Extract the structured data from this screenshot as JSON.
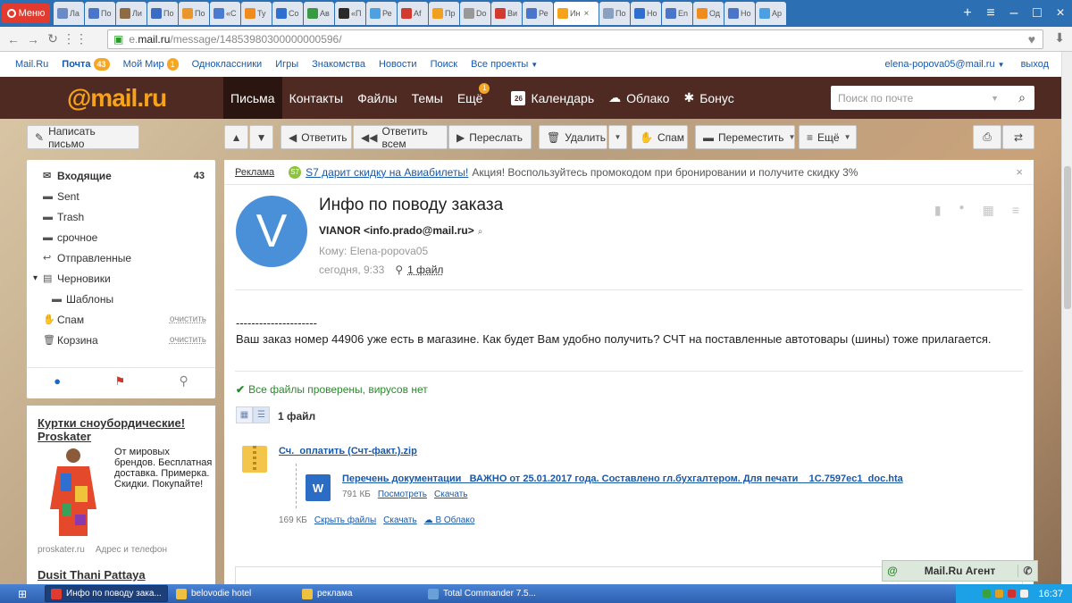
{
  "browser": {
    "menu_label": "Меню",
    "tabs": [
      {
        "title": "Ла",
        "color": "#6b8bc7"
      },
      {
        "title": "По",
        "color": "#4a75c9"
      },
      {
        "title": "Ли",
        "color": "#8c6b45"
      },
      {
        "title": "По",
        "color": "#3b6cc4"
      },
      {
        "title": "По",
        "color": "#e9962c"
      },
      {
        "title": "«С",
        "color": "#4a7bd0"
      },
      {
        "title": "Ту",
        "color": "#f08c1e"
      },
      {
        "title": "Co",
        "color": "#2f6fd0"
      },
      {
        "title": "Ав",
        "color": "#3a9a44"
      },
      {
        "title": "«П",
        "color": "#2a2a2a"
      },
      {
        "title": "Ре",
        "color": "#4fa0e0"
      },
      {
        "title": "Af",
        "color": "#d23a2f"
      },
      {
        "title": "Пр",
        "color": "#f0a020"
      },
      {
        "title": "Do",
        "color": "#999999"
      },
      {
        "title": "Ви",
        "color": "#d23a2f"
      },
      {
        "title": "Ре",
        "color": "#4a75c9"
      },
      {
        "title": "Ин",
        "color": "#f7a21b",
        "active": true
      },
      {
        "title": "По",
        "color": "#8aa0c0"
      },
      {
        "title": "Но",
        "color": "#2f6fd0"
      },
      {
        "title": "En",
        "color": "#4a75c9"
      },
      {
        "title": "Од",
        "color": "#f08c1e"
      },
      {
        "title": "Но",
        "color": "#4a75c9"
      },
      {
        "title": "Ар",
        "color": "#4aa0e0"
      }
    ],
    "url_prefix": "e.",
    "url_domain": "mail.ru",
    "url_path": "/message/14853980300000000596/"
  },
  "portal": {
    "links": [
      "Mail.Ru",
      "Почта",
      "Мой Мир",
      "Одноклассники",
      "Игры",
      "Знакомства",
      "Новости",
      "Поиск",
      "Все проекты"
    ],
    "mail_badge": "43",
    "world_badge": "1",
    "user": "elena-popova05@mail.ru",
    "logout": "выход"
  },
  "header": {
    "logo": "@mail.ru",
    "nav": [
      "Письма",
      "Контакты",
      "Файлы",
      "Темы",
      "Ещё"
    ],
    "more_badge": "1",
    "calendar": "Календарь",
    "calendar_day": "26",
    "cloud": "Облако",
    "bonus": "Бонус",
    "search_placeholder": "Поиск по почте"
  },
  "toolbar": {
    "compose": "Написать письмо",
    "reply": "Ответить",
    "reply_all": "Ответить всем",
    "forward": "Переслать",
    "delete": "Удалить",
    "spam": "Спам",
    "move": "Переместить",
    "more": "Ещё"
  },
  "folders": [
    {
      "name": "Входящие",
      "count": "43",
      "icon": "envelope-icon",
      "selected": true
    },
    {
      "name": "Sent",
      "icon": "folder-icon"
    },
    {
      "name": "Trash",
      "icon": "folder-icon"
    },
    {
      "name": "срочное",
      "icon": "folder-icon"
    },
    {
      "name": "Отправленные",
      "icon": "reply-icon"
    },
    {
      "name": "Черновики",
      "icon": "draft-icon"
    },
    {
      "name": "Шаблоны",
      "icon": "folder-icon",
      "indent": true
    },
    {
      "name": "Спам",
      "icon": "thumbs-down-icon",
      "clear": "очистить"
    },
    {
      "name": "Корзина",
      "icon": "trash-icon",
      "clear": "очистить"
    }
  ],
  "promo": {
    "title": "Куртки сноубордические! Proskater",
    "text": "От мировых брендов. Бесплатная доставка. Примерка. Скидки. Покупайте!",
    "site": "proskater.ru",
    "contacts": "Адрес и телефон",
    "next_title": "Dusit Thani Pattaya"
  },
  "ad": {
    "label": "Реклама",
    "badge": "S7",
    "link": "S7 дарит скидку на Авиабилеты!",
    "text": "Акция! Воспользуйтесь промокодом при бронировании и получите скидку 3%"
  },
  "message": {
    "avatar_letter": "V",
    "subject": "Инфо по поводу заказа",
    "sender": "VIANOR <info.prado@mail.ru>",
    "to": "Кому: Elena-popova05",
    "date": "сегодня, 9:33",
    "files_link": "1 файл",
    "separator": "---------------------",
    "body": "Ваш заказ номер 44906 уже есть в магазине. Как будет Вам удобно получить? СЧТ на поставленные автотовары (шины) тоже прилагается."
  },
  "attachments": {
    "virus_check": "Все файлы проверены, вирусов нет",
    "count_label": "1 файл",
    "zip_name": "Сч._оплатить (Счт-факт.).zip",
    "doc_name": "Перечень документации _ВАЖНО от 25.01.2017 года. Составлено гл.бухгалтером. Для печати__1C.7597ec1_doc.hta",
    "doc_size": "791 КБ",
    "view": "Посмотреть",
    "download": "Скачать",
    "zip_size": "169 КБ",
    "hide_files": "Скрыть файлы",
    "download_zip": "Скачать",
    "to_cloud": "В Облако"
  },
  "agent": {
    "label": "Mail.Ru Агент"
  },
  "taskbar": {
    "tasks": [
      {
        "title": "Инфо по поводу зака...",
        "color": "#e23a2f",
        "active": true
      },
      {
        "title": "belovodie hotel",
        "color": "#f0c040"
      },
      {
        "title": "реклама",
        "color": "#f0c040"
      },
      {
        "title": "Total Commander 7.5...",
        "color": "#6aa0d8"
      }
    ],
    "clock": "16:37"
  }
}
